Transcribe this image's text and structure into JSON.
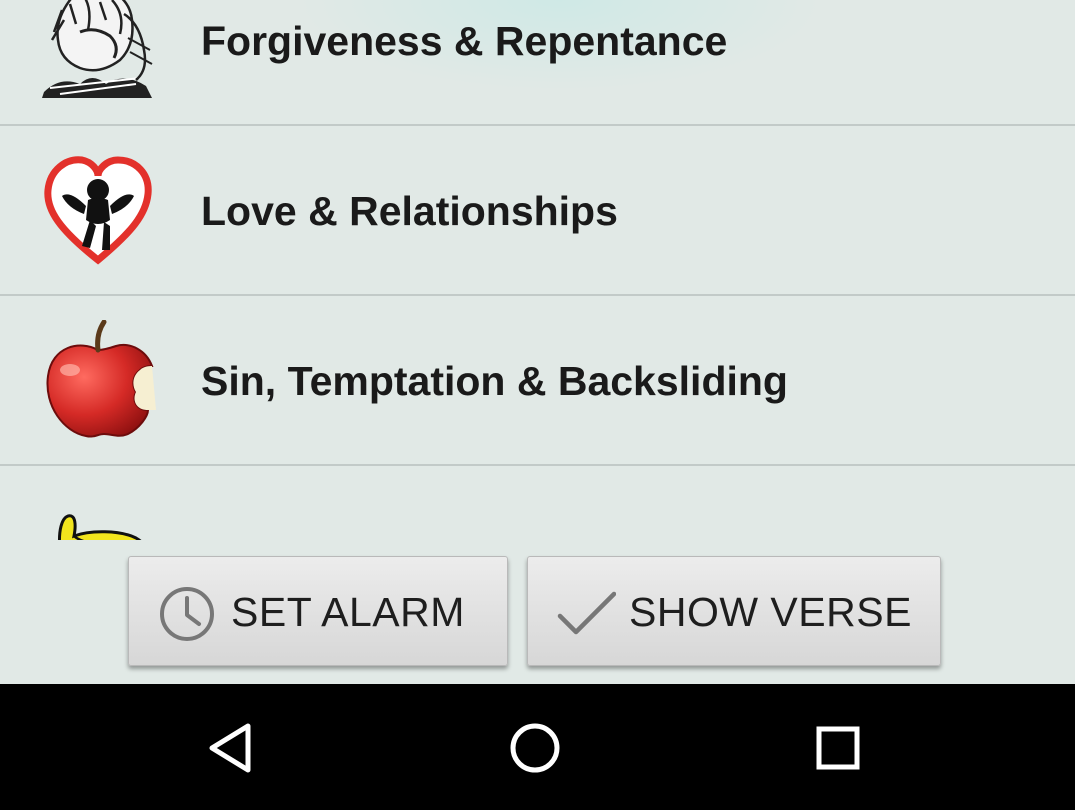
{
  "topics": [
    {
      "label": "Forgiveness & Repentance",
      "icon": "praying-figures-icon"
    },
    {
      "label": "Love & Relationships",
      "icon": "cupid-heart-icon"
    },
    {
      "label": "Sin, Temptation & Backsliding",
      "icon": "bitten-apple-icon"
    },
    {
      "label": "",
      "icon": "yellow-thumbs-icon"
    }
  ],
  "buttons": {
    "set_alarm": {
      "label": "SET ALARM",
      "icon": "clock-icon"
    },
    "show_verse": {
      "label": "SHOW VERSE",
      "icon": "checkmark-icon"
    }
  },
  "navbar": {
    "back": "back-icon",
    "home": "home-icon",
    "recents": "recents-icon"
  },
  "colors": {
    "background": "#e1e9e6",
    "divider": "#c2cac8",
    "button": "#e2e2e2",
    "navbar": "#000000",
    "apple_red": "#d32b2b",
    "heart_red": "#e3312b",
    "thumb_yellow": "#f2e51d"
  }
}
